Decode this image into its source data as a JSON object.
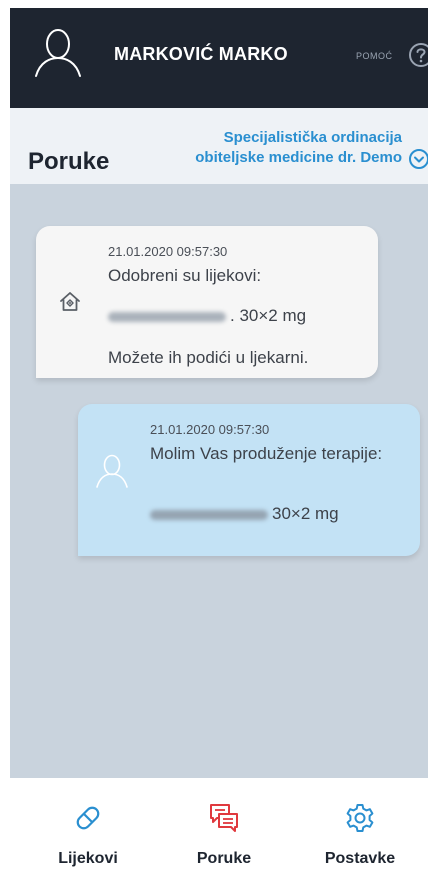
{
  "header": {
    "user_name": "MARKOVIĆ MARKO",
    "help_label": "POMOĆ",
    "avatar_icon": "user-outline-icon",
    "help_icon": "question-circle-icon"
  },
  "subheader": {
    "title": "Poruke",
    "clinic_name": "Specijalistička ordinacija obiteljske medicine dr. Demo",
    "chevron_icon": "chevron-down-circle-icon"
  },
  "messages": [
    {
      "direction": "incoming",
      "icon": "clinic-house-icon",
      "time": "21.01.2020 09:57:30",
      "line1": "Odobreni su lijekovi:",
      "dosage": ". 30×2 mg",
      "line3": "Možete ih podići u ljekarni."
    },
    {
      "direction": "outgoing",
      "icon": "user-outline-icon",
      "time": "21.01.2020 09:57:30",
      "line1": "Molim Vas produženje terapije:",
      "dosage": "30×2 mg"
    }
  ],
  "nav": {
    "items": [
      {
        "label": "Lijekovi",
        "icon": "pill-icon",
        "color": "#2a8fd0"
      },
      {
        "label": "Poruke",
        "icon": "messages-icon",
        "color": "#e0393e"
      },
      {
        "label": "Postavke",
        "icon": "gear-icon",
        "color": "#2a8fd0"
      }
    ]
  },
  "colors": {
    "header_bg": "#1e2530",
    "accent_blue": "#2a8fd0",
    "accent_red": "#e0393e",
    "chat_bg": "#c9d3dd",
    "incoming_bubble": "#f6f6f6",
    "outgoing_bubble": "#c3e2f5"
  }
}
